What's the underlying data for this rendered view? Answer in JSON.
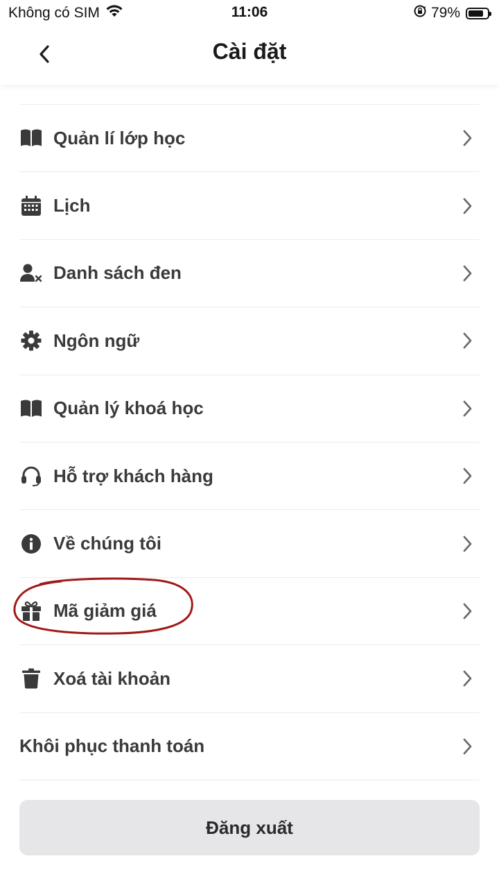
{
  "status_bar": {
    "carrier": "Không có SIM",
    "time": "11:06",
    "battery_percent": "79%",
    "battery_level": 0.79
  },
  "header": {
    "title": "Cài đặt"
  },
  "settings": {
    "items": [
      {
        "label": "Quản lí lớp học",
        "icon": "book-icon"
      },
      {
        "label": "Lịch",
        "icon": "calendar-icon"
      },
      {
        "label": "Danh sách đen",
        "icon": "user-block-icon"
      },
      {
        "label": "Ngôn ngữ",
        "icon": "gear-icon"
      },
      {
        "label": "Quản lý khoá học",
        "icon": "book-icon"
      },
      {
        "label": "Hỗ trợ khách hàng",
        "icon": "headset-icon"
      },
      {
        "label": "Về chúng tôi",
        "icon": "info-icon"
      },
      {
        "label": "Mã giảm giá",
        "icon": "gift-icon"
      },
      {
        "label": "Xoá tài khoản",
        "icon": "trash-icon"
      },
      {
        "label": "Khôi phục thanh toán",
        "icon": ""
      }
    ]
  },
  "logout_label": "Đăng xuất",
  "colors": {
    "icon": "#3a3a3a",
    "chevron": "#6b6b6b",
    "highlight": "#a01818",
    "logout_bg": "#e6e6e9",
    "divider": "#ececec"
  }
}
